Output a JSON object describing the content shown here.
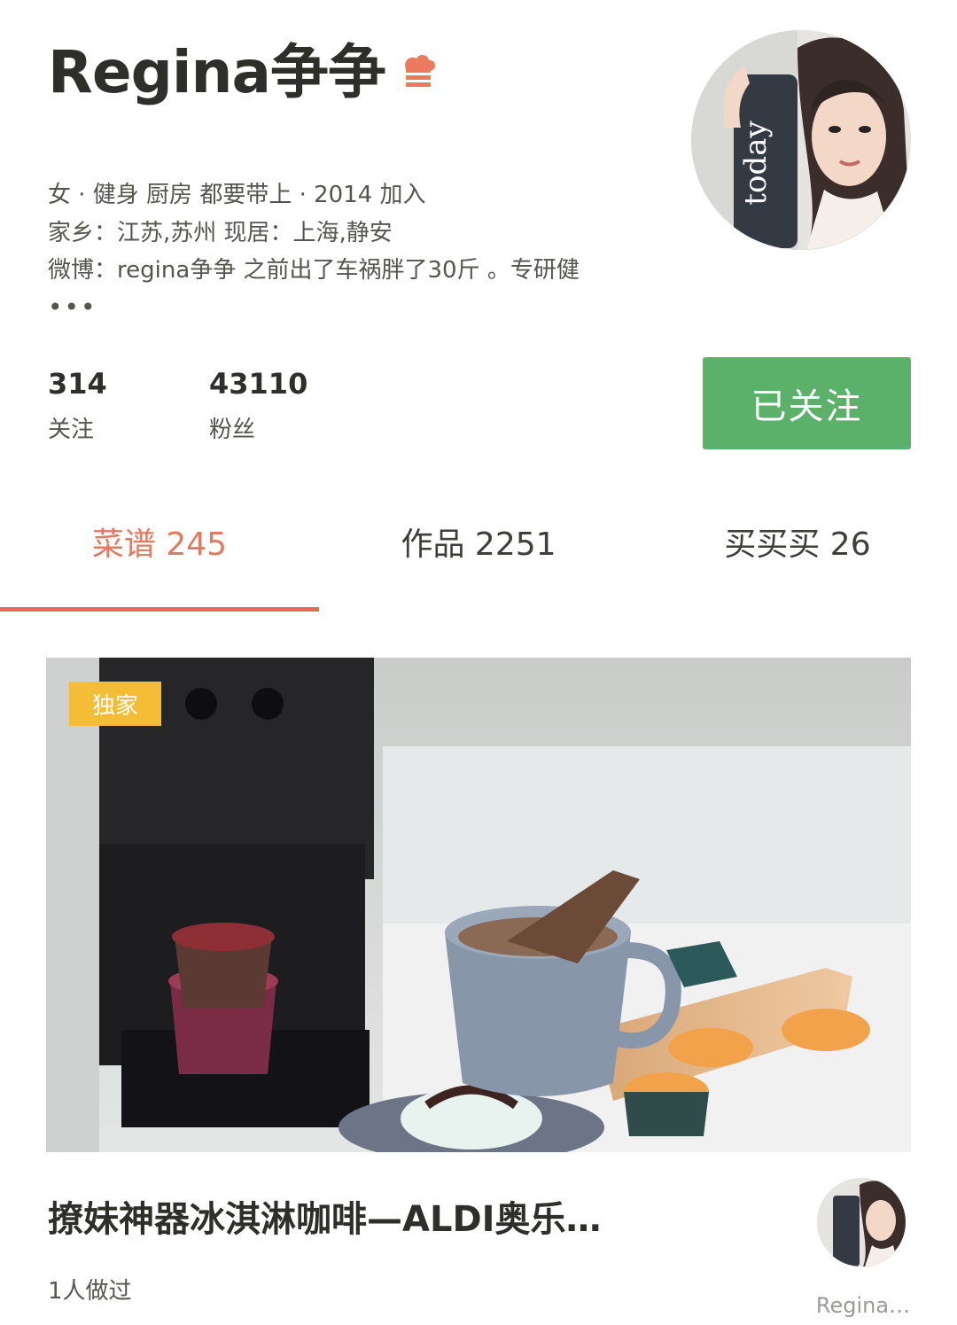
{
  "profile": {
    "name": "Regina争争",
    "bio_line1": "女 · 健身 厨房 都要带上 · 2014 加入",
    "bio_line2": "家乡：江苏,苏州  现居：上海,静安",
    "bio_line3": "微博：regina争争  之前出了车祸胖了30斤 。专研健",
    "bio_more": "•••"
  },
  "stats": {
    "following_count": "314",
    "following_label": "关注",
    "followers_count": "43110",
    "followers_label": "粉丝"
  },
  "follow_button_label": "已关注",
  "tabs": [
    {
      "label": "菜谱 245",
      "active": true
    },
    {
      "label": "作品 2251",
      "active": false
    },
    {
      "label": "买买买 26",
      "active": false
    }
  ],
  "recipe_card": {
    "badge": "独家",
    "title": "撩妹神器冰淇淋咖啡—ALDI奥乐…",
    "made_count": "1人做过",
    "author": "Regina…"
  },
  "colors": {
    "accent": "#e26d50",
    "follow_green": "#5bb06a",
    "badge_yellow": "#f3be35"
  },
  "icons": {
    "chef_badge": "chef-hat-icon"
  }
}
